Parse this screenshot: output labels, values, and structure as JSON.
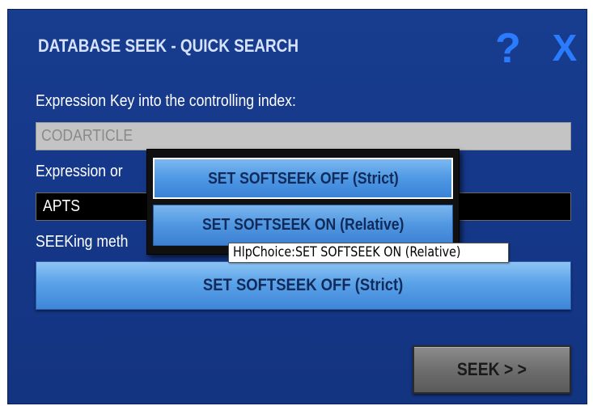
{
  "dialog": {
    "title": "DATABASE SEEK - QUICK SEARCH",
    "help_glyph": "?",
    "close_glyph": "X",
    "accent_color": "#2b7bff",
    "background_color": "#183d8e"
  },
  "form": {
    "key_label": "Expression Key into the controlling index:",
    "key_value": "CODARTICLE",
    "expr_label": "Expression or",
    "expr_value": "APTS",
    "method_label": "SEEKing meth",
    "method_value": "SET SOFTSEEK OFF  (Strict)"
  },
  "popup": {
    "options": [
      {
        "label": "SET SOFTSEEK OFF  (Strict)",
        "selected": true
      },
      {
        "label": "SET SOFTSEEK ON  (Relative)",
        "selected": false
      }
    ]
  },
  "tooltip": {
    "text": "HlpChoice:SET SOFTSEEK ON  (Relative)"
  },
  "actions": {
    "seek_label": "SEEK > >"
  }
}
